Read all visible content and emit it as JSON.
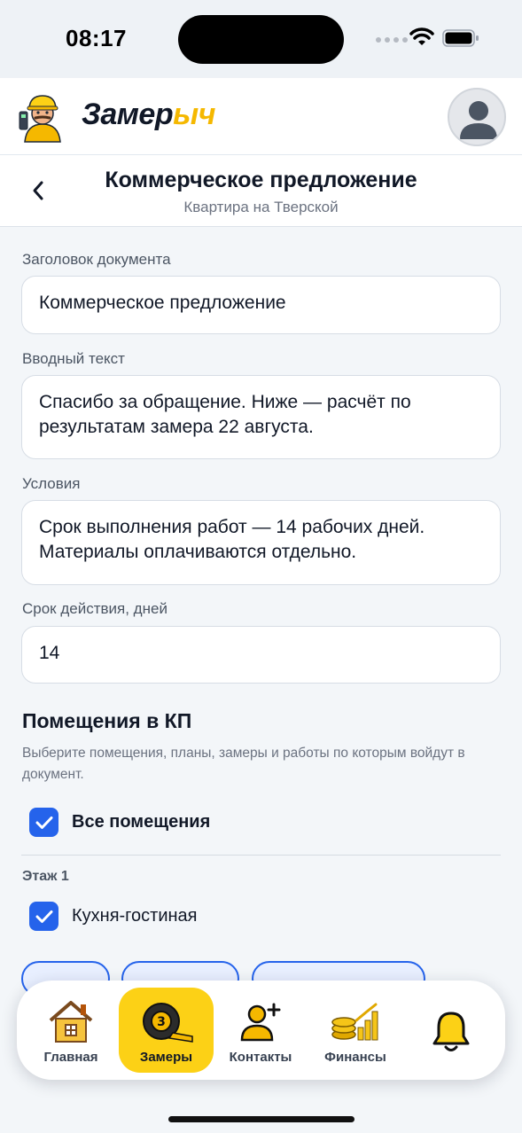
{
  "status": {
    "time": "08:17"
  },
  "app": {
    "logo_part1": "Замер",
    "logo_part2": "ыч"
  },
  "page": {
    "title": "Коммерческое предложение",
    "subtitle": "Квартира на Тверской",
    "back_icon": "chevron-left-icon"
  },
  "form": {
    "doc_title_label": "Заголовок документа",
    "doc_title_value": "Коммерческое предложение",
    "intro_label": "Вводный текст",
    "intro_value": "Спасибо за обращение. Ниже — расчёт по результатам замера 22 августа.",
    "terms_label": "Условия",
    "terms_value": "Срок выполнения работ — 14 рабочих дней. Материалы оплачиваются отдельно.",
    "validity_label": "Срок действия, дней",
    "validity_value": "14"
  },
  "rooms": {
    "title": "Помещения в КП",
    "description": "Выберите помещения, планы, замеры и работы по которым войдут в документ.",
    "all_rooms_label": "Все помещения",
    "all_rooms_checked": true,
    "floor_label": "Этаж 1",
    "room_label": "Кухня-гостиная",
    "room_checked": true
  },
  "nav": {
    "home": "Главная",
    "measures": "Замеры",
    "contacts": "Контакты",
    "finance": "Финансы",
    "active": "measures"
  },
  "colors": {
    "accent": "#2563eb",
    "brand_yellow": "#fcd116",
    "background": "#f3f6f9"
  }
}
